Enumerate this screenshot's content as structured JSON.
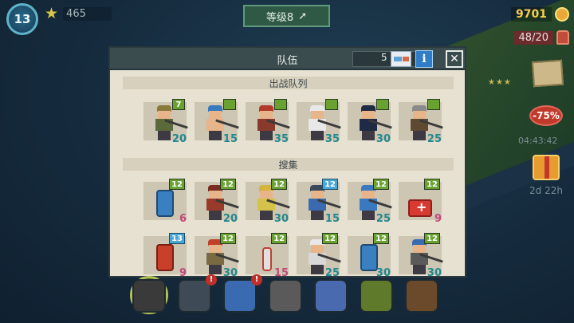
{
  "hud": {
    "level": "13",
    "stars": "465",
    "rank_label": "等级8",
    "coins": "9701",
    "population": "48/20"
  },
  "side": {
    "sale": "-75%",
    "sale_timer": "04:43:42",
    "gift_timer": "2d 22h"
  },
  "panel": {
    "title": "队伍",
    "count": "5",
    "info_label": "i",
    "close_label": "✕",
    "battle_section": "出战队列",
    "gather_section": "搜集"
  },
  "battle_squad": [
    {
      "level": "7",
      "value": "20",
      "kind": "soldier",
      "hat": "#8a7a3a",
      "body": "#5a6a3a"
    },
    {
      "level": "",
      "value": "15",
      "kind": "worker",
      "hat": "#3a78c0",
      "body": "#e8b48a"
    },
    {
      "level": "",
      "value": "35",
      "kind": "bruiser",
      "hat": "#b23a2a",
      "body": "#8a3a2a"
    },
    {
      "level": "",
      "value": "35",
      "kind": "nurse",
      "hat": "#e8e8e8",
      "body": "#e8e8e8"
    },
    {
      "level": "",
      "value": "30",
      "kind": "police",
      "hat": "#1f2a44",
      "body": "#1f2a44"
    },
    {
      "level": "",
      "value": "25",
      "kind": "hunter",
      "hat": "#8a8a8a",
      "body": "#5e4a32"
    }
  ],
  "gather_row1": [
    {
      "level": "12",
      "lvl_color": "green",
      "value": "6",
      "num_color": "pink",
      "kind": "barrel-blue"
    },
    {
      "level": "12",
      "lvl_color": "green",
      "value": "20",
      "num_color": "teal",
      "kind": "firefighter",
      "hat": "#7a2a20",
      "body": "#9a3a2a"
    },
    {
      "level": "12",
      "lvl_color": "green",
      "value": "30",
      "num_color": "teal",
      "kind": "miner",
      "hat": "#d4b43a",
      "body": "#d4c24a"
    },
    {
      "level": "12",
      "lvl_color": "blue",
      "value": "15",
      "num_color": "teal",
      "kind": "scout",
      "hat": "#3a4a5a",
      "body": "#3a6ab0"
    },
    {
      "level": "12",
      "lvl_color": "green",
      "value": "25",
      "num_color": "teal",
      "kind": "guard",
      "hat": "#3a78c0",
      "body": "#3a78c0"
    },
    {
      "level": "12",
      "lvl_color": "green",
      "value": "9",
      "num_color": "pink",
      "kind": "medkit"
    }
  ],
  "gather_row2": [
    {
      "level": "13",
      "lvl_color": "blue",
      "value": "9",
      "num_color": "pink",
      "kind": "barrel-red"
    },
    {
      "level": "12",
      "lvl_color": "green",
      "value": "30",
      "num_color": "teal",
      "kind": "helmet",
      "hat": "#c0402a",
      "body": "#7a6a44"
    },
    {
      "level": "12",
      "lvl_color": "green",
      "value": "15",
      "num_color": "pink",
      "kind": "bottle"
    },
    {
      "level": "12",
      "lvl_color": "green",
      "value": "25",
      "num_color": "teal",
      "kind": "medic",
      "hat": "#e8e8e8",
      "body": "#d8d8d8"
    },
    {
      "level": "12",
      "lvl_color": "green",
      "value": "30",
      "num_color": "teal",
      "kind": "tank-blue"
    },
    {
      "level": "12",
      "lvl_color": "green",
      "value": "30",
      "num_color": "teal",
      "kind": "diver",
      "hat": "#3a6ab0",
      "body": "#5a5a5a"
    }
  ],
  "colors": {
    "panel_bg": "#e6e1d0",
    "header_bg": "#3b4c4f",
    "level_green": "#6aa232",
    "level_blue": "#4ba6d8",
    "num_teal": "#23888e",
    "num_pink": "#c24a7a"
  },
  "dock": [
    {
      "name": "skull-icon"
    },
    {
      "name": "gamepad-icon",
      "alert": "!"
    },
    {
      "name": "radio-icon",
      "alert": "!"
    },
    {
      "name": "terminal-icon"
    },
    {
      "name": "tools-icon"
    },
    {
      "name": "soldier-icon"
    },
    {
      "name": "chest-icon"
    }
  ]
}
